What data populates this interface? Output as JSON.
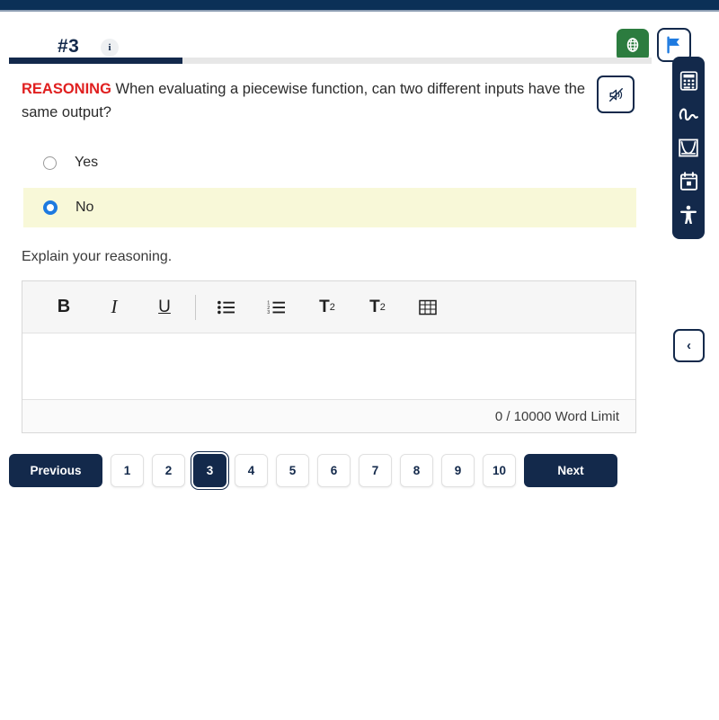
{
  "theme": {
    "navy": "#13294b",
    "green": "#2c7c3f",
    "flag_blue": "#1d7ae0",
    "accent_red": "#e02020",
    "highlight_yellow": "#f8f8d8",
    "radio_blue": "#1d7ae0"
  },
  "header": {
    "question_number": "#3",
    "info_icon_label": "i",
    "info_icon_name": "info-icon",
    "green_button_icon": "globe-icon",
    "flag_button_icon": "flag-icon"
  },
  "progress": {
    "percent": 27
  },
  "question": {
    "tag": "REASONING",
    "text": "When evaluating a piecewise function, can two different inputs have the same output?",
    "audio_button_icon": "speaker-mute-icon"
  },
  "options": [
    {
      "label": "Yes",
      "selected": false
    },
    {
      "label": "No",
      "selected": true
    }
  ],
  "explain": {
    "label": "Explain your reasoning."
  },
  "editor": {
    "toolbar": [
      {
        "name": "bold-button",
        "label": "B"
      },
      {
        "name": "italic-button",
        "label": "I"
      },
      {
        "name": "underline-button",
        "label": "U"
      },
      {
        "name": "bullet-list-button",
        "label": "bullet-list-icon"
      },
      {
        "name": "numbered-list-button",
        "label": "numbered-list-icon"
      },
      {
        "name": "superscript-button",
        "label": "T2-superscript"
      },
      {
        "name": "subscript-button",
        "label": "T2-subscript"
      },
      {
        "name": "table-button",
        "label": "table-icon"
      }
    ],
    "content": "",
    "word_counter": "0 / 10000 Word Limit"
  },
  "pagination": {
    "previous_label": "Previous",
    "next_label": "Next",
    "pages": [
      "1",
      "2",
      "3",
      "4",
      "5",
      "6",
      "7",
      "8",
      "9",
      "10"
    ],
    "active_page": "3"
  },
  "tool_rail": [
    {
      "name": "calculator-tool",
      "icon": "calculator-icon"
    },
    {
      "name": "scribble-tool",
      "icon": "scribble-icon"
    },
    {
      "name": "graph-tool",
      "icon": "graph-icon"
    },
    {
      "name": "notes-tool",
      "icon": "calendar-icon"
    },
    {
      "name": "accessibility-tool",
      "icon": "accessibility-icon"
    }
  ],
  "collapse": {
    "icon": "chevron-left-icon",
    "label": "‹"
  }
}
